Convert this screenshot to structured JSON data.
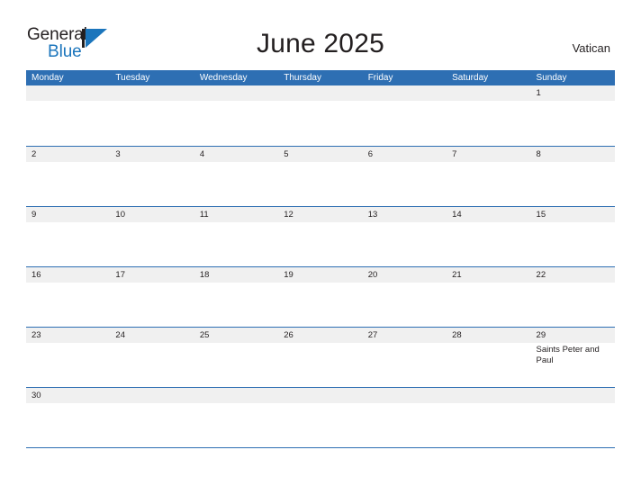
{
  "brand": {
    "name_part1": "General",
    "name_part2": "Blue",
    "mark": "triangle-flag"
  },
  "header": {
    "title": "June 2025",
    "region": "Vatican"
  },
  "calendar": {
    "month": "June",
    "year": "2025",
    "weekday_headers": [
      "Monday",
      "Tuesday",
      "Wednesday",
      "Thursday",
      "Friday",
      "Saturday",
      "Sunday"
    ],
    "colors": {
      "header_blue": "#2e6fb3",
      "band_gray": "#f0f0f0",
      "text": "#231f20",
      "brand_blue": "#1b75bc"
    },
    "weeks": [
      {
        "days": [
          {
            "num": "",
            "events": []
          },
          {
            "num": "",
            "events": []
          },
          {
            "num": "",
            "events": []
          },
          {
            "num": "",
            "events": []
          },
          {
            "num": "",
            "events": []
          },
          {
            "num": "",
            "events": []
          },
          {
            "num": "1",
            "events": []
          }
        ]
      },
      {
        "days": [
          {
            "num": "2",
            "events": []
          },
          {
            "num": "3",
            "events": []
          },
          {
            "num": "4",
            "events": []
          },
          {
            "num": "5",
            "events": []
          },
          {
            "num": "6",
            "events": []
          },
          {
            "num": "7",
            "events": []
          },
          {
            "num": "8",
            "events": []
          }
        ]
      },
      {
        "days": [
          {
            "num": "9",
            "events": []
          },
          {
            "num": "10",
            "events": []
          },
          {
            "num": "11",
            "events": []
          },
          {
            "num": "12",
            "events": []
          },
          {
            "num": "13",
            "events": []
          },
          {
            "num": "14",
            "events": []
          },
          {
            "num": "15",
            "events": []
          }
        ]
      },
      {
        "days": [
          {
            "num": "16",
            "events": []
          },
          {
            "num": "17",
            "events": []
          },
          {
            "num": "18",
            "events": []
          },
          {
            "num": "19",
            "events": []
          },
          {
            "num": "20",
            "events": []
          },
          {
            "num": "21",
            "events": []
          },
          {
            "num": "22",
            "events": []
          }
        ]
      },
      {
        "days": [
          {
            "num": "23",
            "events": []
          },
          {
            "num": "24",
            "events": []
          },
          {
            "num": "25",
            "events": []
          },
          {
            "num": "26",
            "events": []
          },
          {
            "num": "27",
            "events": []
          },
          {
            "num": "28",
            "events": []
          },
          {
            "num": "29",
            "events": [
              "Saints Peter and Paul"
            ]
          }
        ]
      },
      {
        "days": [
          {
            "num": "30",
            "events": []
          },
          {
            "num": "",
            "events": []
          },
          {
            "num": "",
            "events": []
          },
          {
            "num": "",
            "events": []
          },
          {
            "num": "",
            "events": []
          },
          {
            "num": "",
            "events": []
          },
          {
            "num": "",
            "events": []
          }
        ]
      }
    ]
  }
}
